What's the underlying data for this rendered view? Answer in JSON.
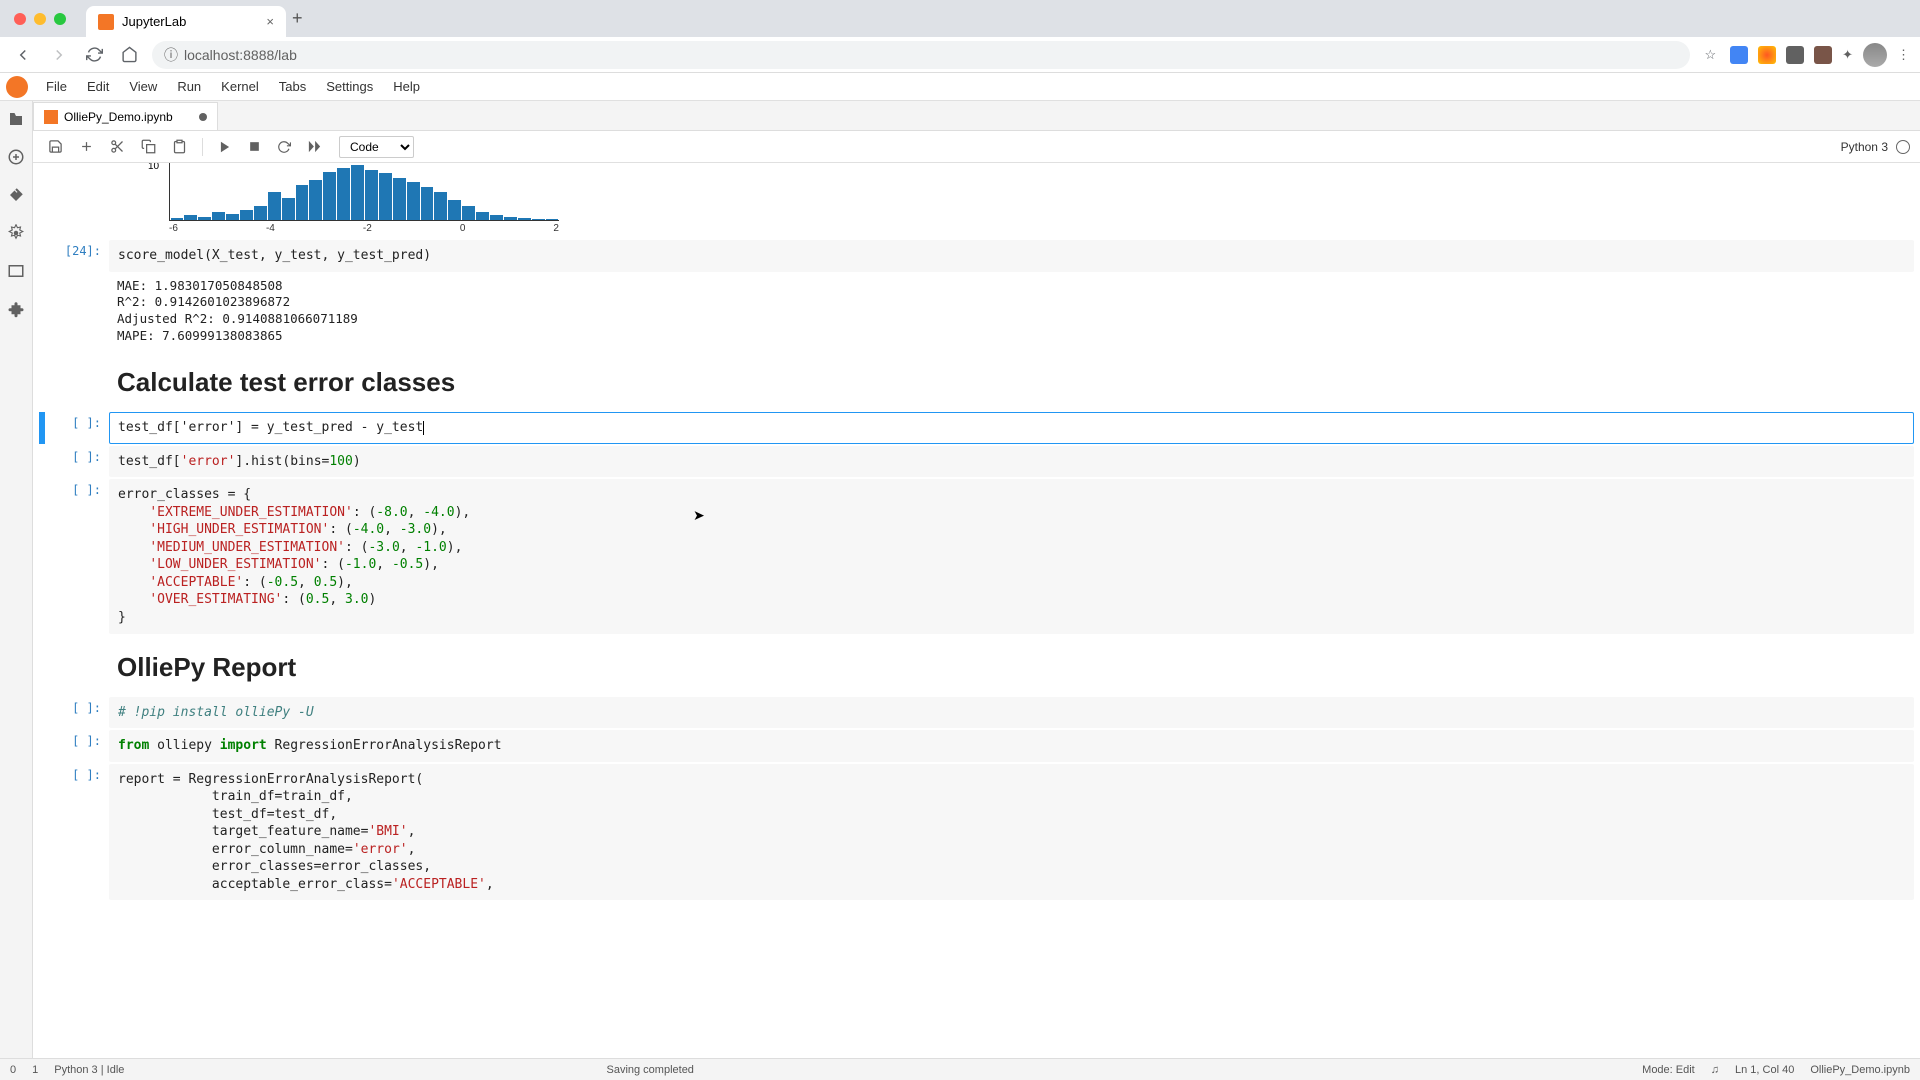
{
  "browser": {
    "tab_title": "JupyterLab",
    "url_display": "localhost:8888/lab"
  },
  "menu": {
    "items": [
      "File",
      "Edit",
      "View",
      "Run",
      "Kernel",
      "Tabs",
      "Settings",
      "Help"
    ]
  },
  "file_tab": {
    "name": "OlliePy_Demo.ipynb"
  },
  "toolbar": {
    "cell_type": "Code",
    "kernel_name": "Python 3"
  },
  "histogram": {
    "ylabel": "10",
    "xticks": [
      "-6",
      "-4",
      "-2",
      "0",
      "2"
    ]
  },
  "cells": {
    "c24_prompt": "[24]:",
    "c24_code": "score_model(X_test, y_test, y_test_pred)",
    "c24_out": "MAE: 1.983017050848508\nR^2: 0.9142601023896872\nAdjusted R^2: 0.9140881066071189\nMAPE: 7.60999138083865",
    "md1": "Calculate test error classes",
    "empty_prompt": "[ ]:",
    "cA_code": "test_df['error'] = y_test_pred - y_test",
    "cB_code_html": "test_df[<span class='tok-str'>'error'</span>].hist(bins=<span class='tok-num'>100</span>)",
    "cC_code_html": "error_classes = {\n    <span class='tok-str'>'EXTREME_UNDER_ESTIMATION'</span>: (<span class='tok-num'>-8.0</span>, <span class='tok-num'>-4.0</span>),\n    <span class='tok-str'>'HIGH_UNDER_ESTIMATION'</span>: (<span class='tok-num'>-4.0</span>, <span class='tok-num'>-3.0</span>),\n    <span class='tok-str'>'MEDIUM_UNDER_ESTIMATION'</span>: (<span class='tok-num'>-3.0</span>, <span class='tok-num'>-1.0</span>),\n    <span class='tok-str'>'LOW_UNDER_ESTIMATION'</span>: (<span class='tok-num'>-1.0</span>, <span class='tok-num'>-0.5</span>),\n    <span class='tok-str'>'ACCEPTABLE'</span>: (<span class='tok-num'>-0.5</span>, <span class='tok-num'>0.5</span>),\n    <span class='tok-str'>'OVER_ESTIMATING'</span>: (<span class='tok-num'>0.5</span>, <span class='tok-num'>3.0</span>)\n}",
    "md2": "OlliePy Report",
    "cD_code_html": "<span class='tok-comment'># !pip install olliePy -U</span>",
    "cE_code_html": "<span class='tok-kw'>from</span> olliepy <span class='tok-kw'>import</span> RegressionErrorAnalysisReport",
    "cF_code_html": "report = RegressionErrorAnalysisReport(\n            train_df=train_df,\n            test_df=test_df,\n            target_feature_name=<span class='tok-str'>'BMI'</span>,\n            error_column_name=<span class='tok-str'>'error'</span>,\n            error_classes=error_classes,\n            acceptable_error_class=<span class='tok-str'>'ACCEPTABLE'</span>,"
  },
  "status": {
    "left1": "0",
    "left2": "1",
    "kernel": "Python 3 | Idle",
    "center": "Saving completed",
    "mode": "Mode: Edit",
    "pos": "Ln 1, Col 40",
    "file": "OlliePy_Demo.ipynb"
  }
}
